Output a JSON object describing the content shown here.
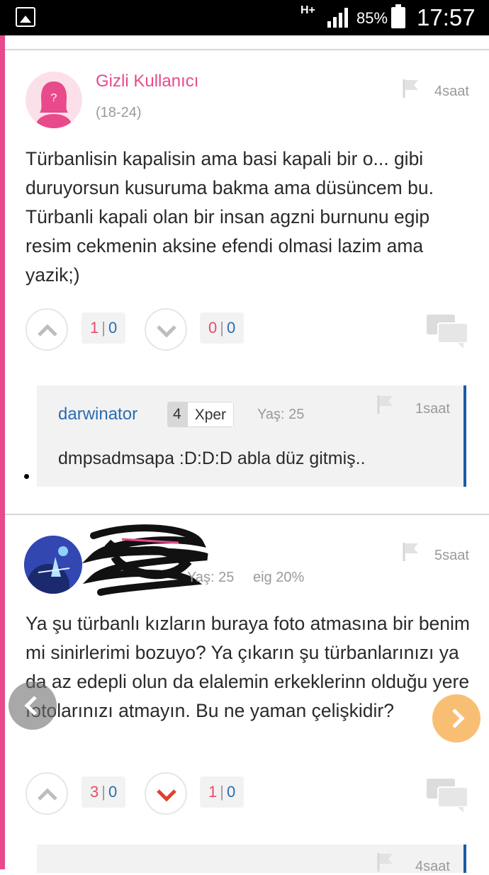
{
  "status_bar": {
    "network": "H+",
    "battery_percent": "85%",
    "time": "17:57"
  },
  "post1": {
    "username": "Gizli Kullanıcı",
    "age": "(18-24)",
    "time_ago": "4saat",
    "body": "Türbanlisin kapalisin ama basi kapali bir o... gibi duruyorsun kusuruma bakma ama düsüncem bu. Türbanli kapali olan bir insan agzni burnunu egip resim cekmenin aksine efendi olmasi lazim ama yazik;)",
    "up_count_a": "1",
    "up_count_b": "0",
    "down_count_a": "0",
    "down_count_b": "0"
  },
  "reply1": {
    "username": "darwinator",
    "level": "4",
    "level_label": "Xper",
    "age": "Yaş: 25",
    "time_ago": "1saat",
    "body": "dmpsadmsapa :D:D:D abla düz gitmiş.."
  },
  "post2": {
    "age": "Yaş: 25",
    "eig": "eig 20%",
    "time_ago": "5saat",
    "body": "Ya şu türbanlı kızların buraya foto atmasına bir benim mi sinirlerimi bozuyo? Ya çıkarın şu türbanlarınızı ya da az edepli olun da elalemin erkeklerinn olduğu yere fotolarınızı atmayın. Bu ne yaman çelişkidir?",
    "up_count_a": "3",
    "up_count_b": "0",
    "down_count_a": "1",
    "down_count_b": "0"
  },
  "reply2": {
    "time_ago": "4saat"
  },
  "colors": {
    "accent_pink": "#e84a8b",
    "reply_blue": "#1c5aa6",
    "downvote_active": "#e0402e"
  }
}
